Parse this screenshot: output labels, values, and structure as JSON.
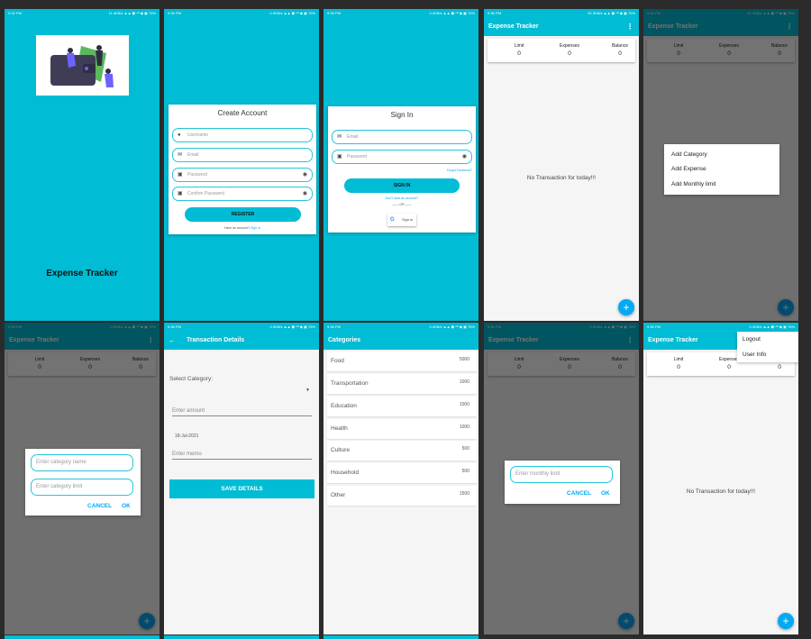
{
  "common": {
    "app_title": "Expense Tracker",
    "limit_label": "Limit",
    "expenses_label": "Expenses",
    "balance_label": "Balance",
    "zero": "0",
    "no_txn": "No Transaction for today!!!",
    "fab": "+",
    "menu_dots": "⋮"
  },
  "statusbars": [
    {
      "time": "9:32 PM",
      "right": "11.4KB/s ▲▲ ◼ ⁴ᴳ ◆ ▣ 76%"
    },
    {
      "time": "9:35 PM",
      "right": "0.0KB/s ▲▲ ◼ ⁴ᴳ ◆ ▣ 76%"
    },
    {
      "time": "9:35 PM",
      "right": "0.4KB/s ▲▲ ◼ ⁴ᴳ ◆ ▣ 76%"
    },
    {
      "time": "9:36 PM",
      "right": "92.3KB/s ▲▲ ◼ ⁴ᴳ ◆ ▣ 76%"
    },
    {
      "time": "9:36 PM",
      "right": "41.1KB/s ▲▲ ◼ ⁴ᴳ ◆ ▣ 76%"
    },
    {
      "time": "9:36 PM",
      "right": "0.2KB/s ▲▲ ◼ ⁴ᴳ ◆ ▣ 76%"
    },
    {
      "time": "9:36 PM",
      "right": "0.0KB/s ▲▲ ◼ ⁴ᴳ ◆ ▣ 76%"
    },
    {
      "time": "9:36 PM",
      "right": "0.4KB/s ▲▲ ◼ ⁴ᴳ ◆ ▣ 76%"
    },
    {
      "time": "9:36 PM",
      "right": "0.0KB/s ▲▲ ◼ ⁴ᴳ ◆ ▣ 76%"
    },
    {
      "time": "9:36 PM",
      "right": "0.2KB/s ▲▲ ◼ ⁴ᴳ ◆ ▣ 76%"
    }
  ],
  "splash": {
    "title": "Expense Tracker"
  },
  "register": {
    "heading": "Create Account",
    "username": "Username",
    "email": "Email",
    "password": "Password",
    "confirm": "Confirm Password",
    "button": "REGISTER",
    "have_account": "Have an account?",
    "sign_in_link": "Sign In"
  },
  "signin": {
    "heading": "Sign In",
    "email": "Email",
    "password": "Password",
    "forgot": "Forgot Password?",
    "button": "SIGN IN",
    "no_account": "Don't have an account?",
    "or": "OR",
    "google": "Sign in"
  },
  "add_menu": [
    "Add Category",
    "Add Expense",
    "Add Monthly limit"
  ],
  "category_dialog": {
    "name_placeholder": "Enter category name",
    "limit_placeholder": "Enter category limit",
    "cancel": "CANCEL",
    "ok": "OK"
  },
  "txn_details": {
    "title": "Transaction Details",
    "select_category": "Select Category:",
    "amount": "Enter amount",
    "date": "18-Jul-2021",
    "memo": "Enter memo",
    "save": "SAVE DETAILS"
  },
  "categories": {
    "title": "Categories",
    "items": [
      {
        "name": "Food",
        "amount": "5000"
      },
      {
        "name": "Transportation",
        "amount": "1000"
      },
      {
        "name": "Education",
        "amount": "1000"
      },
      {
        "name": "Health",
        "amount": "1000"
      },
      {
        "name": "Culture",
        "amount": "500"
      },
      {
        "name": "Household",
        "amount": "500"
      },
      {
        "name": "Other",
        "amount": "1500"
      }
    ]
  },
  "limit_dialog": {
    "placeholder": "Enter monthly limit",
    "cancel": "CANCEL",
    "ok": "OK"
  },
  "overflow_menu": [
    "Logout",
    "User Info"
  ]
}
